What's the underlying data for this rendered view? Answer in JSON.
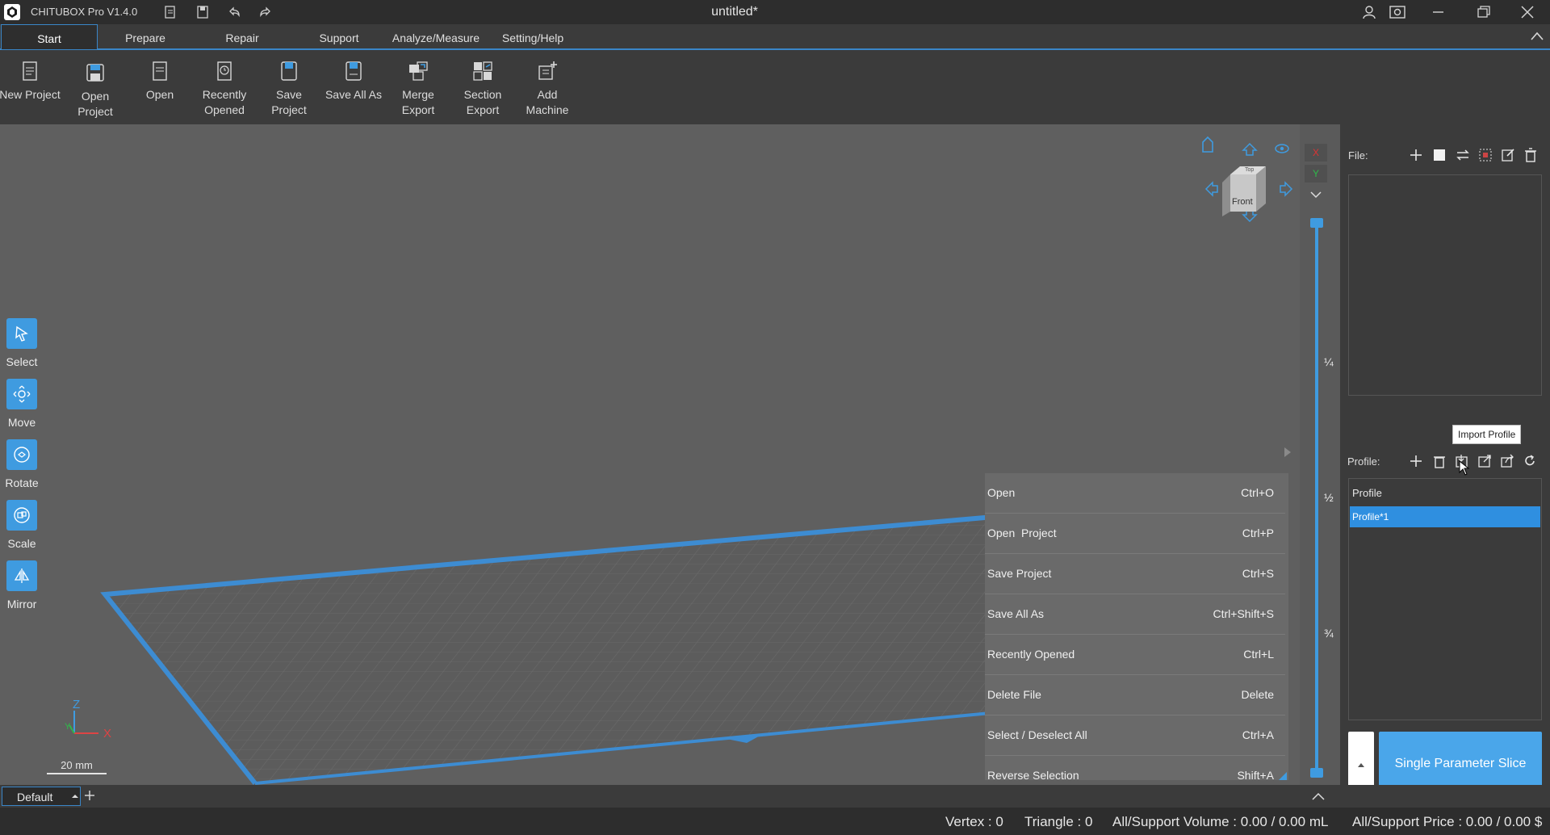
{
  "window": {
    "app_title": "CHITUBOX Pro V1.4.0",
    "doc_title": "untitled*"
  },
  "menu": {
    "tabs": [
      {
        "label": "Start"
      },
      {
        "label": "Prepare"
      },
      {
        "label": "Repair"
      },
      {
        "label": "Support"
      },
      {
        "label": "Analyze/Measure"
      },
      {
        "label": "Setting/Help"
      }
    ],
    "active_tab": "Start"
  },
  "ribbon": {
    "buttons": [
      {
        "label": "New Project",
        "icon": "new-project-icon"
      },
      {
        "label": "Open Project",
        "icon": "open-project-icon"
      },
      {
        "label": "Open",
        "icon": "open-icon"
      },
      {
        "label": "Recently Opened",
        "icon": "recently-opened-icon"
      },
      {
        "label": "Save Project",
        "icon": "save-project-icon"
      },
      {
        "label": "Save All As",
        "icon": "save-all-as-icon"
      },
      {
        "label": "Merge Export",
        "icon": "merge-export-icon"
      },
      {
        "label": "Section Export",
        "icon": "section-export-icon"
      },
      {
        "label": "Add Machine",
        "icon": "add-machine-icon"
      }
    ]
  },
  "tools": [
    {
      "label": "Select",
      "icon": "select-arrow-icon"
    },
    {
      "label": "Move",
      "icon": "move-icon"
    },
    {
      "label": "Rotate",
      "icon": "rotate-icon"
    },
    {
      "label": "Scale",
      "icon": "scale-icon"
    },
    {
      "label": "Mirror",
      "icon": "mirror-icon"
    }
  ],
  "view_cube": {
    "face": "Front",
    "top_face": "Top"
  },
  "axis_indicator": {
    "z": "Z",
    "y": "Y",
    "x": "X",
    "scale": "20 mm"
  },
  "axis_toggles": {
    "x": "X",
    "y": "Y"
  },
  "slider_marks": [
    "¼",
    "½",
    "¾"
  ],
  "context_menu": [
    {
      "label": "Open",
      "shortcut": "Ctrl+O"
    },
    {
      "label": "Open  Project",
      "shortcut": "Ctrl+P"
    },
    {
      "label": "Save Project",
      "shortcut": "Ctrl+S"
    },
    {
      "label": "Save All As",
      "shortcut": "Ctrl+Shift+S"
    },
    {
      "label": "Recently Opened",
      "shortcut": "Ctrl+L"
    },
    {
      "label": "Delete File",
      "shortcut": "Delete"
    },
    {
      "label": "Select / Deselect All",
      "shortcut": "Ctrl+A"
    },
    {
      "label": "Reverse Selection",
      "shortcut": "Shift+A"
    }
  ],
  "right_panel": {
    "file_label": "File:",
    "profile_label": "Profile:",
    "profile_list_header": "Profile",
    "profiles": [
      {
        "name": "Profile*1",
        "selected": true
      }
    ],
    "tooltip": "Import Profile",
    "slice_button": "Single Parameter Slice"
  },
  "bottom": {
    "plate_tab": "Default"
  },
  "status": {
    "vertex": "Vertex : 0",
    "triangle": "Triangle : 0",
    "volume": "All/Support Volume : 0.00 / 0.00 mL",
    "price": "All/Support Price : 0.00 / 0.00 $"
  },
  "colors": {
    "accent": "#3f9be0",
    "selection": "#2f8fe0",
    "plate_edge": "#3d8cd2",
    "background": "#5f5f5f",
    "panel": "#3b3b3b"
  }
}
